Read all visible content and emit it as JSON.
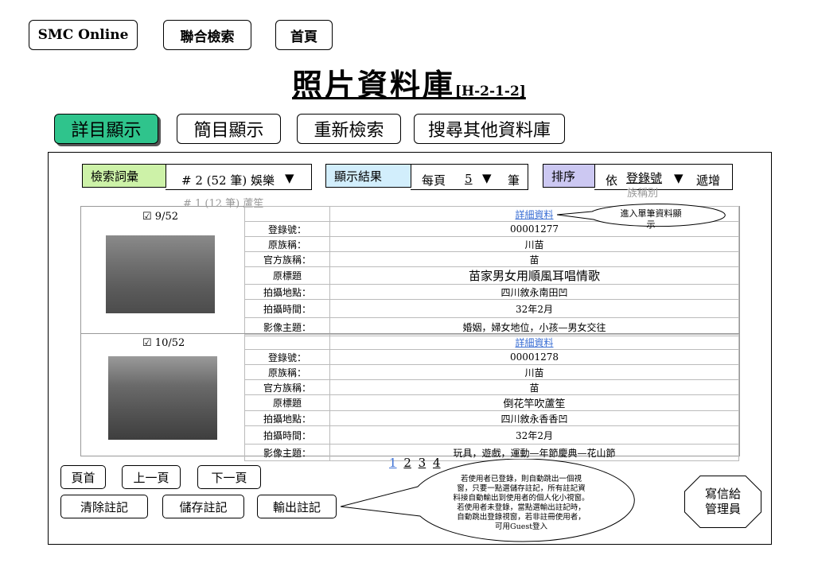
{
  "top_nav": {
    "smc": "SMC Online",
    "union": "聯合檢索",
    "home": "首頁"
  },
  "title": {
    "main": "照片資料庫",
    "code": "[H-2-1-2]"
  },
  "tabs": {
    "detail": "詳目顯示",
    "brief": "簡目顯示",
    "research": "重新檢索",
    "other": "搜尋其他資料庫"
  },
  "controls": {
    "term_label": "檢索詞彙",
    "term_value": "# 2 (52 筆) 娛樂",
    "term_alt": "# 1 (12 筆) 蘆笙",
    "display_label": "顯示結果",
    "per_page": "每頁",
    "per_page_value": "5",
    "per_page_unit": "筆",
    "sort_label": "排序",
    "sort_by": "依",
    "sort_field": "登錄號",
    "sort_field_alt": "族稱別",
    "sort_dir": "遞增",
    "dropdown_arrow": "▼"
  },
  "callouts": {
    "detail": "進入單筆資料顯示",
    "notes": [
      "若使用者已登錄，則自動跳出一個視",
      "窗，只要一點選儲存註記，所有註記資",
      "料接自動輸出到使用者的個人化小視窗。",
      "若使用者未登錄，當點選輸出註記時，",
      "自動跳出登錄視窗，若非註冊使用者，",
      "可用Guest登入"
    ]
  },
  "field_labels": [
    "登錄號：",
    "原族稱：",
    "官方族稱：",
    "原標題",
    "拍攝地點：",
    "拍攝時間：",
    "影像主題："
  ],
  "records": [
    {
      "check": "☑",
      "index": "9/52",
      "detail_link": "詳細資料",
      "values": [
        "00001277",
        "川苗",
        "苗",
        "苗家男女用順風耳唱情歌",
        "四川敘永南田凹",
        "32年2月",
        "婚姻，婦女地位，小孩—男女交往"
      ]
    },
    {
      "check": "☑",
      "index": "10/52",
      "detail_link": "詳細資料",
      "values": [
        "00001278",
        "川苗",
        "苗",
        "倒花竿吹蘆笙",
        "四川敘永香香凹",
        "32年2月",
        "玩具，遊戲，運動—年節慶典—花山節"
      ]
    }
  ],
  "pager": {
    "first": "頁首",
    "prev": "上一頁",
    "next": "下一頁",
    "pages": [
      "1",
      "2",
      "3",
      "4"
    ]
  },
  "actions": {
    "clear": "清除註記",
    "save": "儲存註記",
    "export": "輸出註記"
  },
  "write_admin": [
    "寫信給",
    "管理員"
  ]
}
